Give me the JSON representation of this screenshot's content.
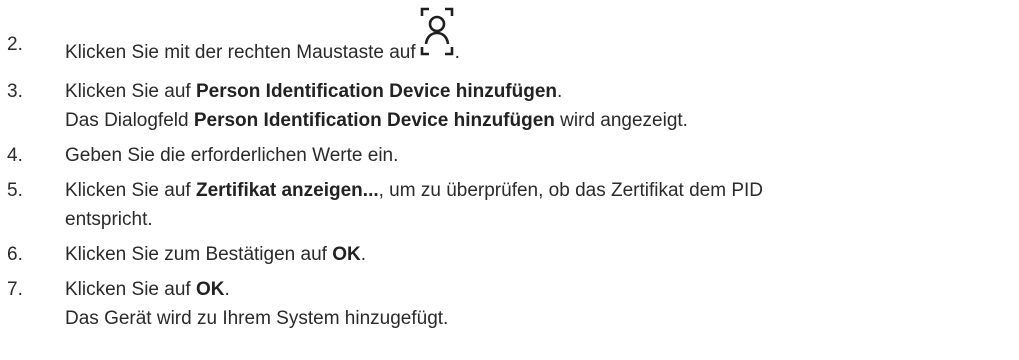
{
  "steps": [
    {
      "number": "2.",
      "text_before_icon": "Klicken Sie mit der rechten Maustaste auf",
      "icon": "face-recognition-icon",
      "text_after_icon": "."
    },
    {
      "number": "3.",
      "pre": "Klicken Sie auf ",
      "bold": "Person Identification Device hinzufügen",
      "post": ".",
      "result_pre": "Das Dialogfeld ",
      "result_bold": "Person Identification Device hinzufügen",
      "result_post": " wird angezeigt."
    },
    {
      "number": "4.",
      "text": "Geben Sie die erforderlichen Werte ein."
    },
    {
      "number": "5.",
      "pre": "Klicken Sie auf ",
      "bold": "Zertifikat anzeigen...",
      "post": ", um zu überprüfen, ob das Zertifikat dem PID",
      "continuation": "entspricht."
    },
    {
      "number": "6.",
      "pre": "Klicken Sie zum Bestätigen auf ",
      "bold": "OK",
      "post": "."
    },
    {
      "number": "7.",
      "pre": "Klicken Sie auf ",
      "bold": "OK",
      "post": ".",
      "result": "Das Gerät wird zu Ihrem System hinzugefügt."
    }
  ]
}
